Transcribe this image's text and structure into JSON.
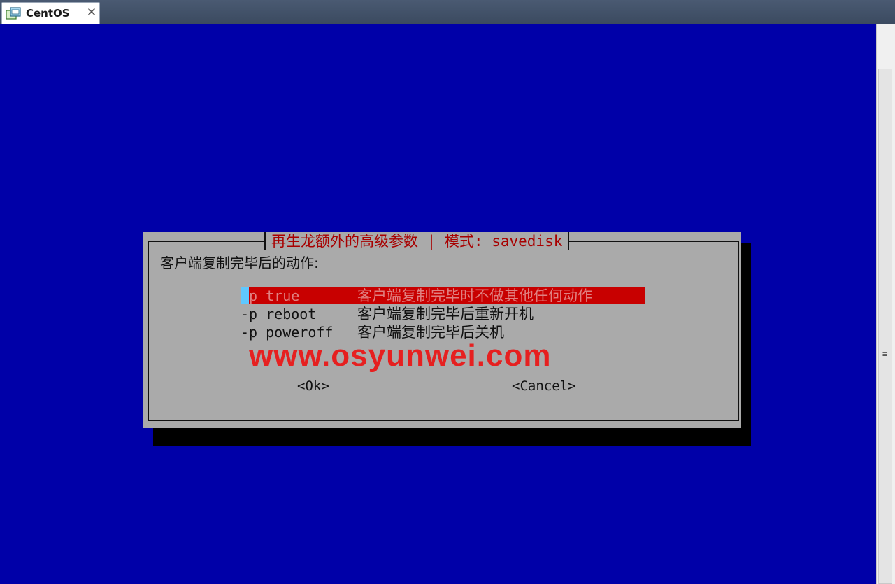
{
  "tab": {
    "title": "CentOS",
    "close_glyph": "✕",
    "icon": "vm-icon"
  },
  "dialog": {
    "title": "再生龙额外的高级参数 | 模式: savedisk",
    "prompt": "客户端复制完毕后的动作:",
    "options": [
      {
        "flag": "-p true",
        "description": "客户端复制完毕时不做其他任何动作",
        "selected": true
      },
      {
        "flag": "-p reboot",
        "description": "客户端复制完毕后重新开机",
        "selected": false
      },
      {
        "flag": "-p poweroff",
        "description": "客户端复制完毕后关机",
        "selected": false
      }
    ],
    "ok_label": "<Ok>",
    "cancel_label": "<Cancel>"
  },
  "watermark": "www.osyunwei.com",
  "colors": {
    "console_bg": "#0000a8",
    "dialog_bg": "#aaaaaa",
    "selection": "#c80000",
    "title_text": "#a80000",
    "watermark": "#e62020"
  }
}
